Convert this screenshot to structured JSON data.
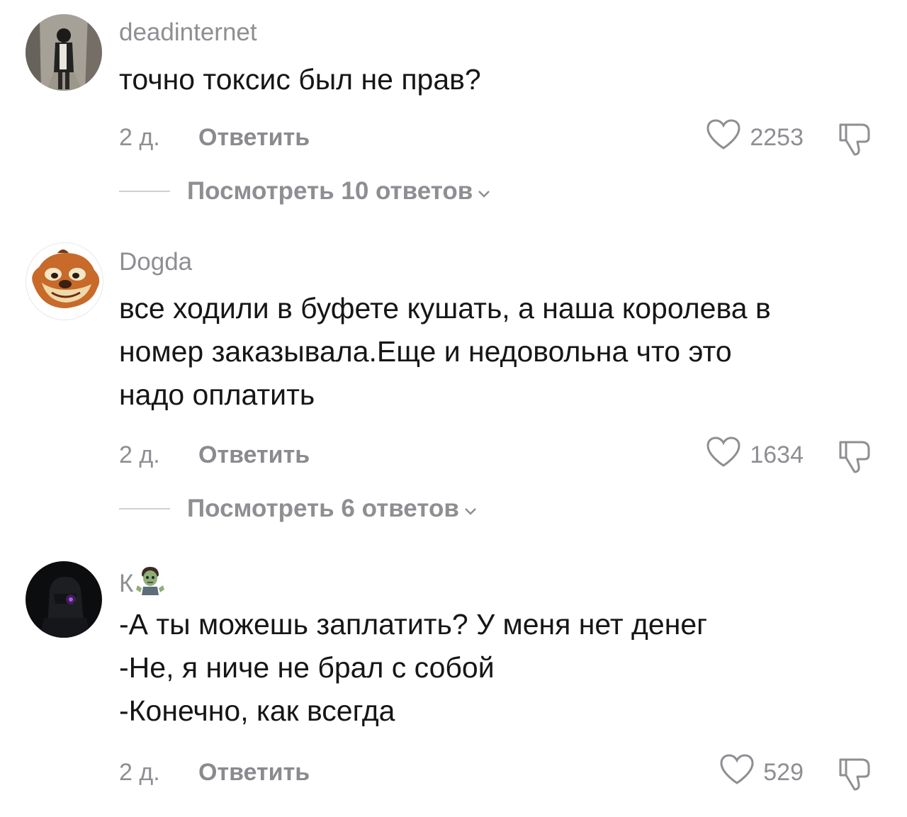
{
  "comments": [
    {
      "author": "deadinternet",
      "text": "точно токсис был не прав?",
      "age": "2 д.",
      "reply_label": "Ответить",
      "likes": "2253",
      "view_replies": "Посмотреть 10 ответов"
    },
    {
      "author": "Dogda",
      "text": "все ходили в буфете кушать, а наша королева в\nномер заказывала.Еще и недовольна что это\nнадо оплатить",
      "age": "2 д.",
      "reply_label": "Ответить",
      "likes": "1634",
      "view_replies": "Посмотреть 6 ответов"
    },
    {
      "author": "К",
      "author_emoji": "zombie-emoji",
      "text": "-А ты можешь заплатить? У меня нет денег\n-Не, я ниче не брал с собой\n-Конечно, как всегда",
      "age": "2 д.",
      "reply_label": "Ответить",
      "likes": "529"
    }
  ],
  "icons": {
    "like": "heart-outline-icon",
    "dislike": "thumbs-down-outline-icon",
    "expand": "chevron-down-icon"
  },
  "colors": {
    "text": "#161616",
    "secondary": "#8e8e93"
  }
}
